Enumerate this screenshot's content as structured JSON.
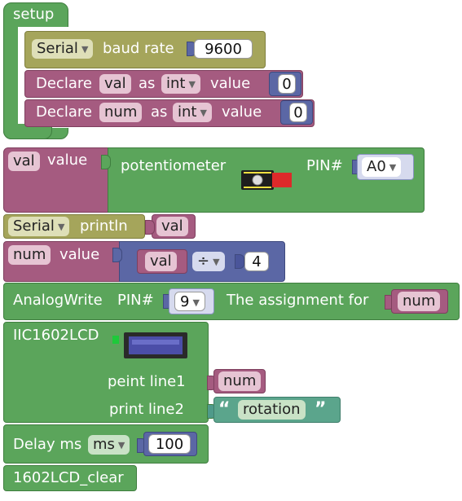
{
  "setup": {
    "title": "setup",
    "serial_dropdown": "Serial",
    "baud_label": "baud rate",
    "baud_value": "9600",
    "declare1": {
      "label": "Declare",
      "var": "val",
      "as": "as",
      "type": "int",
      "value_label": "value",
      "value": "0"
    },
    "declare2": {
      "label": "Declare",
      "var": "num",
      "as": "as",
      "type": "int",
      "value_label": "value",
      "value": "0"
    }
  },
  "val_assign": {
    "var": "val",
    "value_label": "value",
    "sensor_label": "potentiometer",
    "pin_label": "PIN#",
    "pin_value": "A0"
  },
  "println": {
    "serial": "Serial",
    "label": "println",
    "var": "val"
  },
  "num_assign": {
    "var": "num",
    "value_label": "value",
    "left_var": "val",
    "operator": "÷",
    "right_value": "4"
  },
  "analogwrite": {
    "label": "AnalogWrite",
    "pin_label": "PIN#",
    "pin_value": "9",
    "assign_label": "The assignment for",
    "var": "num"
  },
  "lcd": {
    "title": "IIC1602LCD",
    "line1_label": "peint line1",
    "line1_var": "num",
    "line2_label": "print line2",
    "line2_quote_open": "“",
    "line2_text": "rotation",
    "line2_quote_close": "”"
  },
  "delay": {
    "label": "Delay ms",
    "unit": "ms",
    "value": "100"
  },
  "clear": {
    "label": "1602LCD_clear"
  },
  "colors": {
    "control": "#5ba55b",
    "serial": "#a5a55b",
    "variable": "#a55b80",
    "math": "#5b67a5",
    "lcd_screen": "#4b4ea8"
  },
  "icons": [
    "potentiometer-module-icon",
    "lcd-1602-module-icon",
    "dropdown-arrow-icon"
  ]
}
